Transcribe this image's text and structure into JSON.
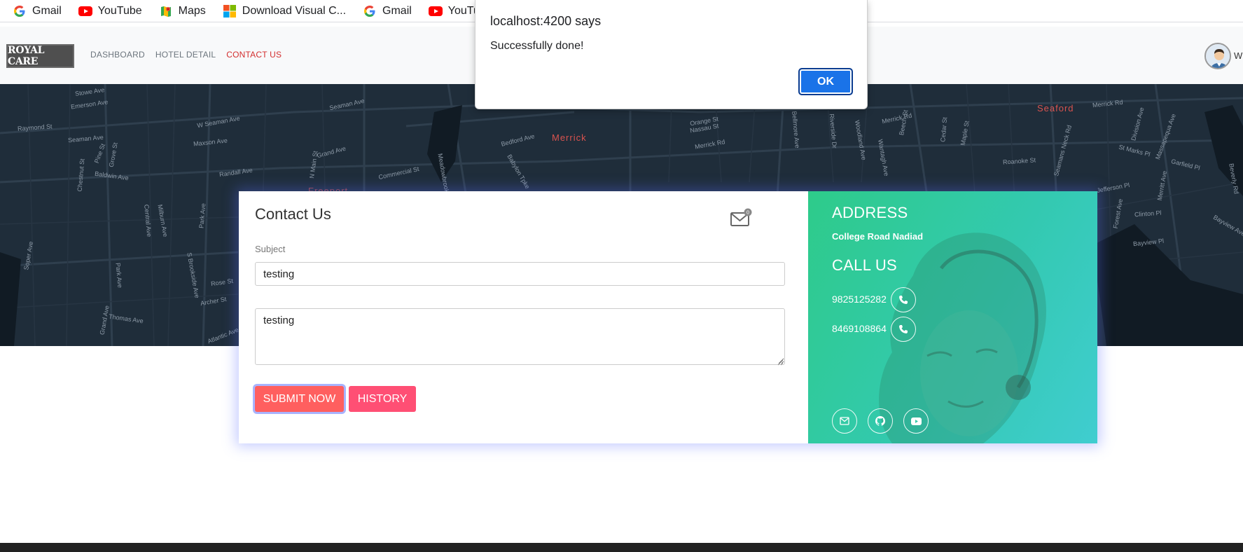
{
  "bookmarks": [
    {
      "label": "Gmail",
      "icon": "google-icon"
    },
    {
      "label": "YouTube",
      "icon": "youtube-icon"
    },
    {
      "label": "Maps",
      "icon": "maps-icon"
    },
    {
      "label": "Download Visual C...",
      "icon": "microsoft-icon"
    },
    {
      "label": "Gmail",
      "icon": "google-icon"
    },
    {
      "label": "YouTube",
      "icon": "youtube-icon"
    }
  ],
  "navbar": {
    "brand": "ROYAL CARE",
    "links": [
      "DASHBOARD",
      "HOTEL DETAIL",
      "CONTACT US"
    ],
    "active_link": "CONTACT US",
    "user_name": "W"
  },
  "map": {
    "towns": [
      "Merrick",
      "Seaford",
      "Freeport"
    ],
    "streets": [
      "Stowe Ave",
      "Emerson Ave",
      "Seaman Ave",
      "Raymond St",
      "W Seaman Ave",
      "Maxson Ave",
      "Seaman Ave",
      "Pine St",
      "Grove St",
      "Baldwin Ave",
      "Randall Ave",
      "N Main St",
      "Grand Ave",
      "Commercial St",
      "Meadowbrook",
      "Bedford Ave",
      "Babylon Tpke",
      "Orange St",
      "Nassau St",
      "Merrick Rd",
      "Merrick Rd",
      "Merrick Rd",
      "Roanoke St",
      "St Marks Pl",
      "Garfield Pl",
      "Clinton Pl",
      "Bayview Ave",
      "Bayview Pl",
      "Jefferson Pl",
      "Chestnut St",
      "Central Ave",
      "Milburn Ave",
      "Park Ave",
      "Park Ave",
      "Rose St",
      "Archer St",
      "Thomas Ave",
      "Atlantic Ave",
      "Grand Ave",
      "Soper Ave",
      "S Brookside Ave",
      "Division Ave",
      "Bellmore Ave",
      "Riverside Dr",
      "Woodland Ave",
      "Wantagh Ave",
      "Maple St",
      "Cedar St",
      "Beech St",
      "Seamans Neck Rd",
      "Forest Ave",
      "Merritt Ave",
      "Beverly Rd",
      "Massapequa Ave"
    ]
  },
  "contact_form": {
    "title": "Contact Us",
    "mail_badge": "0",
    "subject_label": "Subject",
    "subject_value": "testing",
    "message_value": "testing",
    "submit_label": "SUBMIT NOW",
    "history_label": "HISTORY"
  },
  "info": {
    "address_heading": "ADDRESS",
    "address": "College Road Nadiad",
    "call_heading": "CALL US",
    "phones": [
      "9825125282",
      "8469108864"
    ],
    "social_icons": [
      "mail-icon",
      "github-icon",
      "youtube-icon"
    ]
  },
  "dialog": {
    "title": "localhost:4200 says",
    "message": "Successfully done!",
    "ok_label": "OK"
  },
  "colors": {
    "accent_red": "#d32f2f",
    "submit": "#ff5f5f",
    "history": "#ff4f74",
    "info_gradient_start": "#2ecb8a",
    "info_gradient_end": "#40cdd0",
    "dialog_ok": "#1a73e8"
  }
}
